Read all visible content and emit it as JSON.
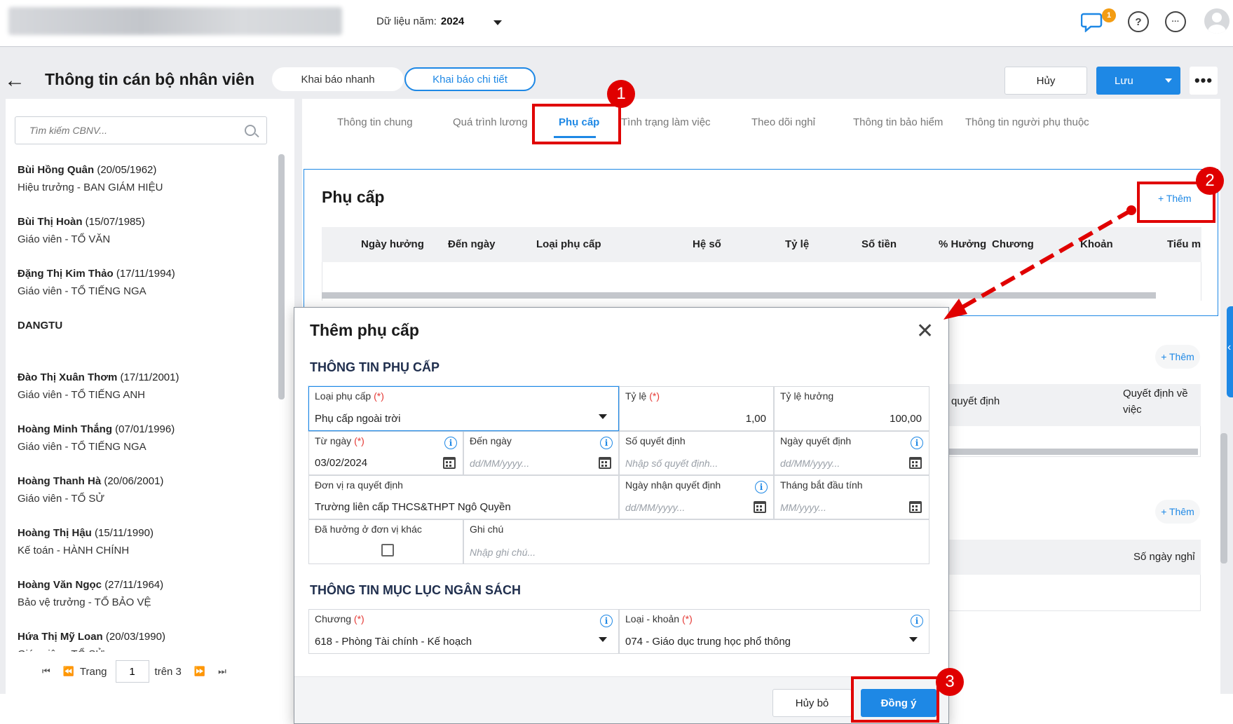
{
  "header": {
    "year_label": "Dữ liệu năm:",
    "year_value": "2024",
    "notif_count": "1",
    "help_glyph": "?",
    "more_glyph": "···"
  },
  "toolbar": {
    "back_glyph": "←",
    "title": "Thông tin cán bộ nhân viên",
    "quick_label": "Khai báo nhanh",
    "detail_label": "Khai báo chi tiết",
    "cancel_label": "Hủy",
    "save_label": "Lưu",
    "more_glyph": "•••"
  },
  "sidebar": {
    "search_placeholder": "Tìm kiếm CBNV...",
    "employees": [
      {
        "name": "Bùi Hồng Quân",
        "dob": "(20/05/1962)",
        "role": "Hiệu trưởng - BAN GIÁM HIỆU"
      },
      {
        "name": "Bùi Thị Hoàn",
        "dob": "(15/07/1985)",
        "role": "Giáo viên - TỔ VĂN"
      },
      {
        "name": "Đặng Thị Kim Thảo",
        "dob": "(17/11/1994)",
        "role": "Giáo viên - TỔ TIẾNG NGA"
      },
      {
        "name": "DANGTU",
        "dob": "",
        "role": ""
      },
      {
        "name": "Đào Thị Xuân Thơm",
        "dob": "(17/11/2001)",
        "role": "Giáo viên - TỔ TIẾNG ANH"
      },
      {
        "name": "Hoàng Minh Thắng",
        "dob": "(07/01/1996)",
        "role": "Giáo viên - TỔ TIẾNG NGA"
      },
      {
        "name": "Hoàng Thanh Hà",
        "dob": "(20/06/2001)",
        "role": "Giáo viên - TỔ SỬ"
      },
      {
        "name": "Hoàng Thị Hậu",
        "dob": "(15/11/1990)",
        "role": "Kế toán - HÀNH CHÍNH"
      },
      {
        "name": "Hoàng Văn Ngọc",
        "dob": "(27/11/1964)",
        "role": "Bảo vệ trưởng - TỔ BẢO VỆ"
      },
      {
        "name": "Hứa Thị Mỹ Loan",
        "dob": "(20/03/1990)",
        "role": "Giáo viên - TỔ SỬ"
      }
    ],
    "pager": {
      "first": "⏮",
      "prev": "⏪",
      "page_label": "Trang",
      "page_value": "1",
      "of_label": "trên 3",
      "next": "⏩",
      "last": "⏭"
    }
  },
  "tabs": [
    "Thông tin chung",
    "Quá trình lương",
    "Phụ cấp",
    "Tình trạng làm việc",
    "Theo dõi nghỉ",
    "Thông tin bảo hiểm",
    "Thông tin người phụ thuộc"
  ],
  "allowance": {
    "title": "Phụ cấp",
    "add_label": "+ Thêm",
    "columns": [
      "Ngày hưởng",
      "Đến ngày",
      "Loại phụ cấp",
      "Hệ số",
      "Tỷ lệ",
      "Số tiền",
      "% Hưởng",
      "Chương",
      "Khoản",
      "Tiểu m"
    ]
  },
  "background": {
    "add2": "+ Thêm",
    "add3": "+ Thêm",
    "t2_col_a": "quyết định",
    "t2_col_b": "Quyết định về việc",
    "t3_col_a": "Số ngày nghỉ"
  },
  "dialog": {
    "title": "Thêm phụ cấp",
    "close_glyph": "✕",
    "section1": "THÔNG TIN PHỤ CẤP",
    "section2": "THÔNG TIN MỤC LỤC NGÂN SÁCH",
    "req_mark": "(*)",
    "info_glyph": "i",
    "fields": {
      "loai_phu_cap": {
        "label": "Loại phụ cấp",
        "value": "Phụ cấp ngoài trời"
      },
      "ty_le": {
        "label": "Tỷ lệ",
        "value": "1,00"
      },
      "ty_le_huong": {
        "label": "Tỷ lệ hưởng",
        "value": "100,00"
      },
      "tu_ngay": {
        "label": "Từ ngày",
        "value": "03/02/2024"
      },
      "den_ngay": {
        "label": "Đến ngày",
        "placeholder": "dd/MM/yyyy..."
      },
      "so_quyet_dinh": {
        "label": "Số quyết định",
        "placeholder": "Nhập số quyết định..."
      },
      "ngay_quyet_dinh": {
        "label": "Ngày quyết định",
        "placeholder": "dd/MM/yyyy..."
      },
      "don_vi": {
        "label": "Đơn vị ra quyết định",
        "value": "Trường liên cấp THCS&THPT Ngô Quyền"
      },
      "ngay_nhan": {
        "label": "Ngày nhận quyết định",
        "placeholder": "dd/MM/yyyy..."
      },
      "thang_bat_dau": {
        "label": "Tháng bắt đầu tính",
        "placeholder": "MM/yyyy..."
      },
      "da_huong": {
        "label": "Đã hưởng ở đơn vị khác"
      },
      "ghi_chu": {
        "label": "Ghi chú",
        "placeholder": "Nhập ghi chú..."
      },
      "chuong": {
        "label": "Chương",
        "value": "618 - Phòng Tài chính - Kế hoạch"
      },
      "loai_khoan": {
        "label": "Loại - khoản",
        "value": "074 - Giáo dục trung học phổ thông"
      }
    },
    "cancel_label": "Hủy bỏ",
    "ok_label": "Đồng ý"
  },
  "annotations": {
    "step1": "1",
    "step2": "2",
    "step3": "3",
    "color": "#e00000"
  },
  "colors": {
    "accent": "#1e88e5",
    "required": "#e53935"
  }
}
